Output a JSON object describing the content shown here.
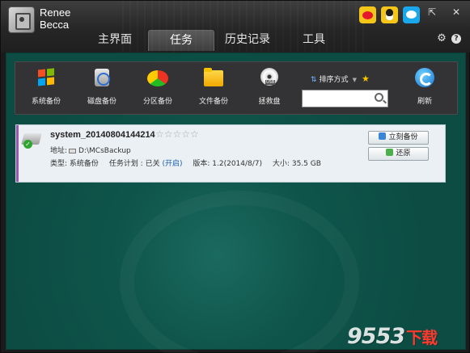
{
  "header": {
    "brand_line1": "Renee",
    "brand_line2": "Becca",
    "tabs": [
      {
        "label": "主界面",
        "active": false
      },
      {
        "label": "任务",
        "active": true
      },
      {
        "label": "历史记录",
        "active": false
      },
      {
        "label": "工具",
        "active": false
      }
    ],
    "social_icons": [
      "weibo-icon",
      "qq-icon",
      "chat-icon"
    ],
    "window_controls": {
      "restore": "⇱",
      "close": "✕"
    },
    "settings_glyph": "⚙",
    "help_glyph": "?"
  },
  "toolbar": {
    "tools": [
      {
        "label": "系统备份",
        "icon": "windows-icon"
      },
      {
        "label": "磁盘备份",
        "icon": "disk-icon"
      },
      {
        "label": "分区备份",
        "icon": "partition-pie-icon"
      },
      {
        "label": "文件备份",
        "icon": "folder-icon"
      },
      {
        "label": "拯救盘",
        "icon": "rescue-disc-icon"
      },
      {
        "label": "刷新",
        "icon": "refresh-icon"
      }
    ],
    "sort_label": "排序方式",
    "sort_arrow": "⇅",
    "sort_caret": "▼",
    "star_glyph": "★",
    "search": {
      "value": "",
      "placeholder": ""
    }
  },
  "task": {
    "name": "system_20140804144214",
    "stars": "☆☆☆☆☆",
    "ok_glyph": "✓",
    "address_label": "地址:",
    "address_value": "D:\\MCsBackup",
    "type_label": "类型:",
    "type_value": "系统备份",
    "plan_label": "任务计划 : 已关",
    "plan_link": "(开启)",
    "version_label": "版本:",
    "version_value": "1.2(2014/8/7)",
    "size_label": "大小:",
    "size_value": "35.5 GB",
    "backup_button": "立刻备份",
    "restore_button": "还原"
  },
  "watermark": {
    "part1": "9553",
    "part2": "下载"
  }
}
